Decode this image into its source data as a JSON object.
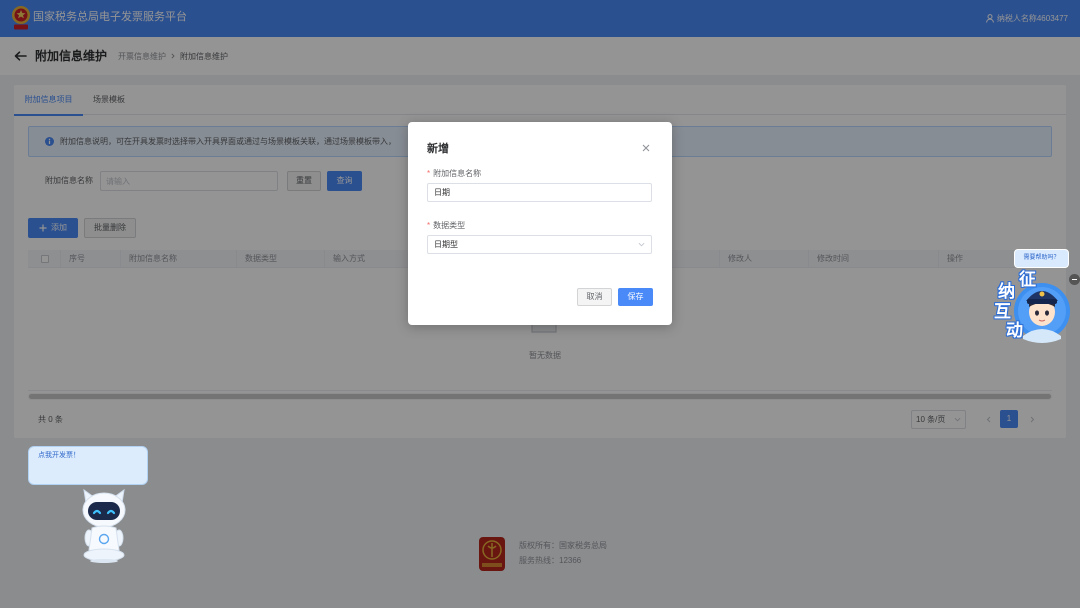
{
  "theme": {
    "primary": "#4a8af8",
    "page_bg": "#f0f2f5",
    "required": "#f56c6c"
  },
  "header": {
    "title": "国家税务总局电子发票服务平台",
    "user_name": "纳税人名称4603477",
    "logo_icon": "tax-emblem-icon",
    "user_icon": "user-icon"
  },
  "page_header": {
    "title": "附加信息维护",
    "breadcrumb": [
      "开票信息维护",
      "附加信息维护"
    ],
    "back_icon": "arrow-left-icon"
  },
  "tabs": [
    {
      "label": "附加信息项目",
      "active": true
    },
    {
      "label": "场景模板",
      "active": false
    }
  ],
  "alert": {
    "icon": "info-icon",
    "text": "附加信息说明，可在开具发票时选择带入开具界面或通过与场景模板关联，通过场景模板带入，"
  },
  "search": {
    "label": "附加信息名称",
    "placeholder": "请输入",
    "value": "",
    "reset_label": "重置",
    "query_label": "查询"
  },
  "toolbar": {
    "add_label": "添加",
    "batch_delete_label": "批量删除"
  },
  "table": {
    "columns": [
      "序号",
      "附加信息名称",
      "数据类型",
      "输入方式",
      "修改人",
      "修改时间",
      "操作"
    ],
    "rows": [],
    "empty_text": "暂无数据"
  },
  "pagination": {
    "total_text": "共 0 条",
    "page_size": "10 条/页",
    "current_page": "1"
  },
  "footer": {
    "copyright": "版权所有：国家税务总局",
    "hotline": "服务热线：12366"
  },
  "assistant_bot": {
    "bubble_text": "点我开发票！"
  },
  "help_widget": {
    "bubble_text": "需要帮助吗？",
    "characters": [
      "征",
      "纳",
      "互",
      "动"
    ]
  },
  "modal": {
    "title": "新增",
    "required_mark": "*",
    "fields": [
      {
        "label": "附加信息名称",
        "required": true,
        "value": "日期"
      },
      {
        "label": "数据类型",
        "required": true,
        "value": "日期型"
      }
    ],
    "cancel_label": "取消",
    "save_label": "保存"
  }
}
